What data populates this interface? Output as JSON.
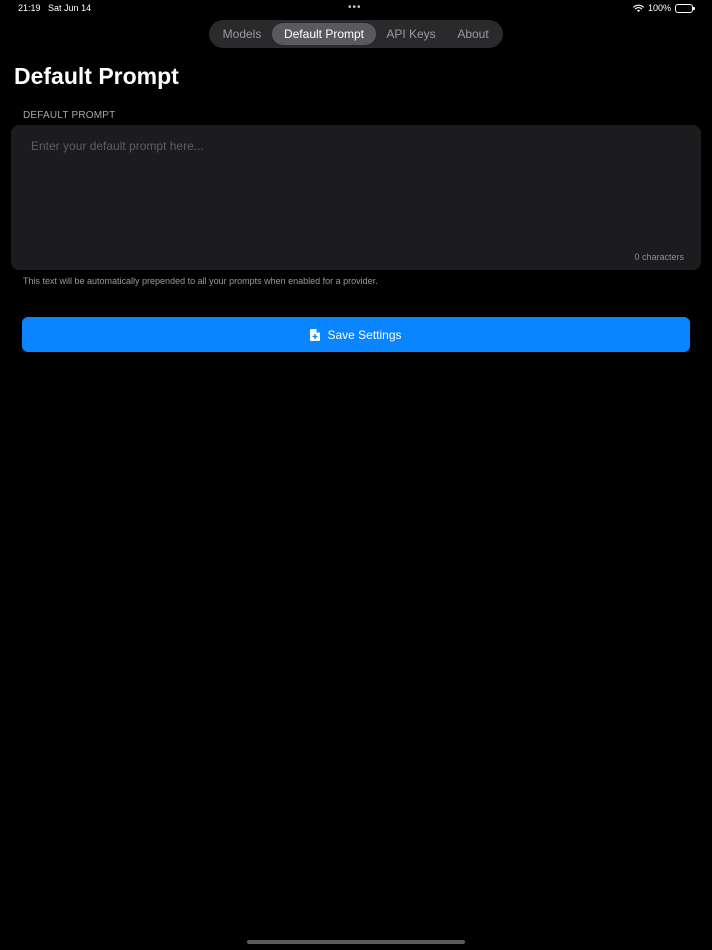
{
  "status_bar": {
    "time": "21:19",
    "date": "Sat Jun 14",
    "dots": "•••",
    "battery": "100%"
  },
  "tabs": [
    {
      "label": "Models",
      "selected": false
    },
    {
      "label": "Default Prompt",
      "selected": true
    },
    {
      "label": "API Keys",
      "selected": false
    },
    {
      "label": "About",
      "selected": false
    }
  ],
  "page": {
    "title": "Default Prompt",
    "section_label": "DEFAULT PROMPT",
    "prompt": {
      "value": "",
      "placeholder": "Enter your default prompt here...",
      "char_count": "0 characters"
    },
    "helper_text": "This text will be automatically prepended to all your prompts when enabled for a provider.",
    "save_label": "Save Settings"
  },
  "colors": {
    "accent": "#0a84ff",
    "background": "#000000",
    "card": "#1c1c1e"
  },
  "icons": {
    "save": "document-icon",
    "wifi": "wifi-icon",
    "battery": "battery-icon"
  }
}
